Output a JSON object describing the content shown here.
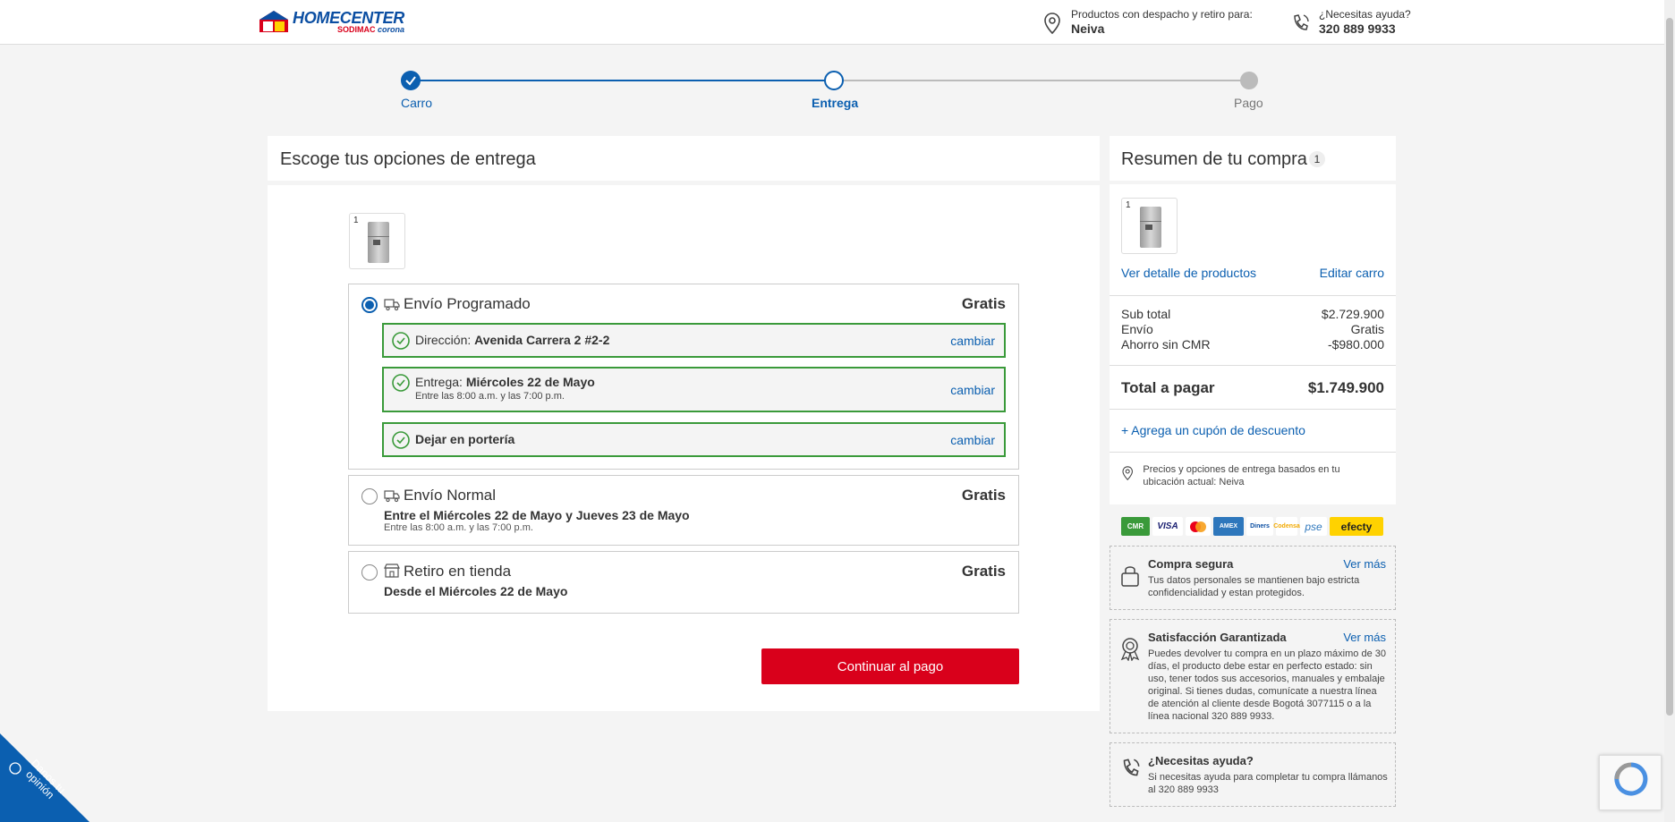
{
  "header": {
    "logo_main": "HOMECENTER",
    "logo_sub_1": "SODIMAC",
    "logo_sub_2": "corona",
    "location_label": "Productos con despacho y retiro para:",
    "location_value": "Neiva",
    "help_label": "¿Necesitas ayuda?",
    "help_phone": "320 889 9933"
  },
  "stepper": {
    "steps": [
      {
        "label": "Carro",
        "state": "done"
      },
      {
        "label": "Entrega",
        "state": "current"
      },
      {
        "label": "Pago",
        "state": "pending"
      }
    ]
  },
  "main": {
    "title": "Escoge tus opciones de entrega",
    "product_qty": "1",
    "options": [
      {
        "title": "Envío Programado",
        "price": "Gratis",
        "selected": true,
        "details": [
          {
            "label": "Dirección:",
            "value": "Avenida Carrera 2 #2-2",
            "link": "cambiar"
          },
          {
            "label": "Entrega:",
            "value": "Miércoles 22 de Mayo",
            "note": "Entre las 8:00 a.m. y las 7:00 p.m.",
            "link": "cambiar"
          },
          {
            "label": "",
            "value": "Dejar en portería",
            "link": "cambiar"
          }
        ]
      },
      {
        "title": "Envío Normal",
        "price": "Gratis",
        "selected": false,
        "sub": "Entre el Miércoles 22 de Mayo y Jueves 23 de Mayo",
        "note": "Entre las 8:00 a.m. y las 7:00 p.m."
      },
      {
        "title": "Retiro en tienda",
        "price": "Gratis",
        "selected": false,
        "sub": "Desde el Miércoles 22 de Mayo"
      }
    ],
    "continue_label": "Continuar al pago"
  },
  "summary": {
    "title": "Resumen de tu compra",
    "count": "1",
    "product_qty": "1",
    "view_details": "Ver detalle de productos",
    "edit_cart": "Editar carro",
    "rows": [
      {
        "label": "Sub total",
        "value": "$2.729.900"
      },
      {
        "label": "Envío",
        "value": "Gratis"
      },
      {
        "label": "Ahorro sin CMR",
        "value": "-$980.000"
      }
    ],
    "total_label": "Total a pagar",
    "total_value": "$1.749.900",
    "coupon": "+ Agrega un cupón de descuento",
    "location_note": "Precios y opciones de entrega basados en tu ubicación actual: Neiva"
  },
  "payment_logos": [
    "CMR",
    "VISA",
    "MC",
    "AMEX",
    "Diners",
    "Codensa",
    "pse",
    "efecty"
  ],
  "info": [
    {
      "title": "Compra segura",
      "more": "Ver más",
      "text": "Tus datos personales se mantienen bajo estricta confidencialidad y estan protegidos."
    },
    {
      "title": "Satisfacción Garantizada",
      "more": "Ver más",
      "text": "Puedes devolver tu compra en un plazo máximo de 30 días, el producto debe estar en perfecto estado: sin uso, tener todos sus accesorios, manuales y embalaje original. Si tienes dudas, comunícate a nuestra línea de atención al cliente desde Bogotá 3077115 o a la línea nacional 320 889 9933."
    },
    {
      "title": "¿Necesitas ayuda?",
      "more": "",
      "text": "Si necesitas ayuda para completar tu compra llámanos al 320 889 9933"
    }
  ],
  "feedback_label": "Danos tu opinión",
  "colors": {
    "brand_blue": "#0b5fb0",
    "brand_red": "#d9001b",
    "success_green": "#3a9a3a"
  }
}
